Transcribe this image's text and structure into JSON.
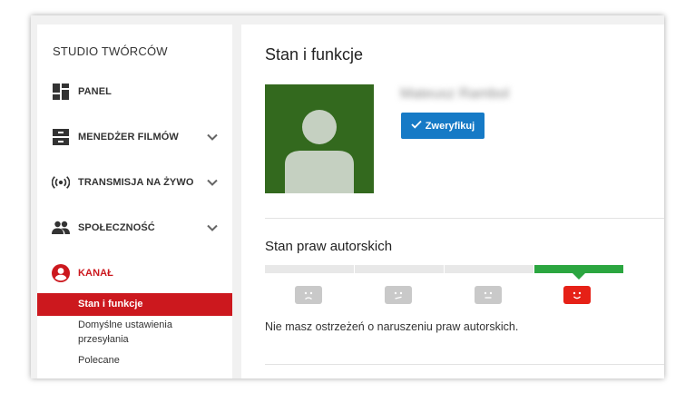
{
  "sidebar": {
    "title": "STUDIO TWÓRCÓW",
    "items": [
      {
        "label": "PANEL"
      },
      {
        "label": "MENEDŻER FILMÓW"
      },
      {
        "label": "TRANSMISJA NA ŻYWO"
      },
      {
        "label": "SPOŁECZNOŚĆ"
      },
      {
        "label": "KANAŁ"
      }
    ],
    "sub_items": [
      {
        "label": "Stan i funkcje"
      },
      {
        "label": "Domyślne ustawienia przesyłania"
      },
      {
        "label": "Polecane"
      }
    ],
    "active_color": "#cc181e"
  },
  "main": {
    "title": "Stan i funkcje",
    "channel_name": "Mateusz Rambol",
    "verify_label": "Zweryfikuj",
    "copyright": {
      "title": "Stan praw autorskich",
      "status": "Nie masz ostrzeżeń o naruszeniu praw autorskich.",
      "current_level": 4,
      "levels": 4,
      "good_color": "#2ba640",
      "current_face_color": "#e62117"
    },
    "avatar_color": "#33691e",
    "button_color": "#167ac6"
  }
}
